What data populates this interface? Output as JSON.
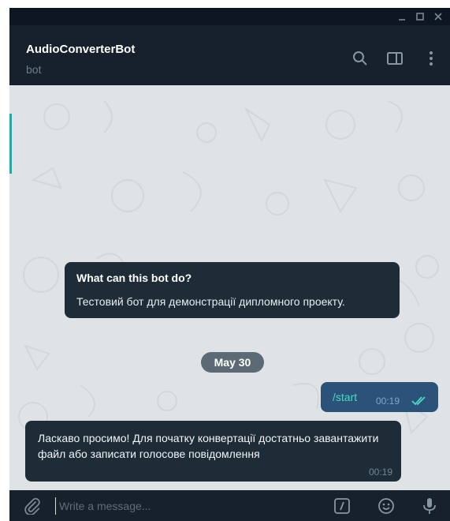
{
  "window": {
    "controls": [
      "minimize-icon",
      "maximize-icon",
      "close-icon"
    ]
  },
  "header": {
    "title": "AudioConverterBot",
    "subtitle": "bot",
    "icons": [
      "search-icon",
      "sidebar-toggle-icon",
      "more-vert-icon"
    ]
  },
  "chat": {
    "bot_info": {
      "question": "What can this bot do?",
      "description": "Тестовий бот для демонстрації дипломного проекту."
    },
    "date_label": "May 30",
    "messages": [
      {
        "direction": "out",
        "text": "/start",
        "time": "00:19",
        "status": "read"
      },
      {
        "direction": "in",
        "text": "Ласкаво просимо! Для початку конвертації достатньо завантажити файл або записати голосове повідомлення",
        "time": "00:19"
      }
    ]
  },
  "composer": {
    "placeholder": "Write a message...",
    "icons": [
      "attach-icon",
      "bot-commands-icon",
      "emoji-icon",
      "microphone-icon"
    ]
  },
  "colors": {
    "header_bg": "#17212b",
    "chat_bg": "#dfe3e6",
    "bubble_in": "#1e2c38",
    "bubble_out": "#2b5278",
    "accent": "#4fd7c6"
  }
}
